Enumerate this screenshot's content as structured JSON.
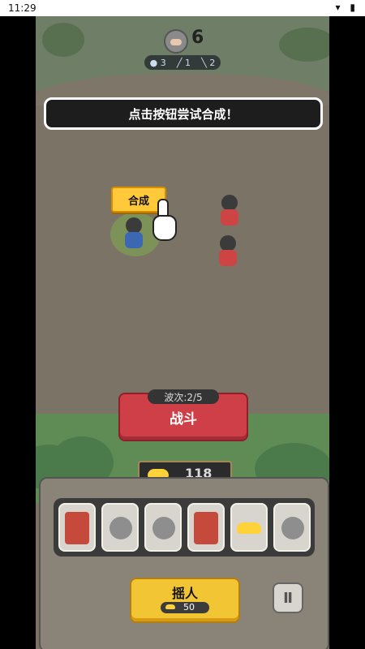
{
  "status_bar": {
    "time": "11:29",
    "icons": [
      "wifi-icon",
      "battery-icon"
    ]
  },
  "enemy": {
    "count": "6",
    "resources": [
      "3",
      "1",
      "2"
    ]
  },
  "hint": {
    "text": "点击按钮尝试合成！"
  },
  "merge": {
    "label": "合成"
  },
  "wave": {
    "label": "波次:2/5"
  },
  "fight": {
    "label": "战斗"
  },
  "gold": {
    "count": "118"
  },
  "slots": [
    "card",
    "unit",
    "unit",
    "card",
    "gold",
    "unit"
  ],
  "recruit": {
    "label": "摇人",
    "cost": "50"
  },
  "pause": {
    "icon": "pause-icon"
  }
}
